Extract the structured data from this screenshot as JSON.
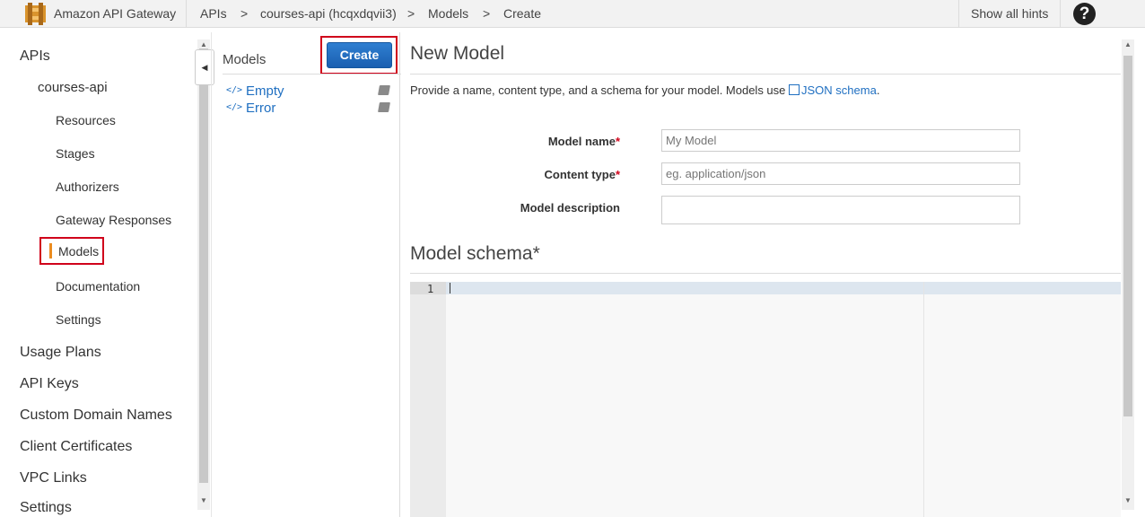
{
  "topbar": {
    "brand": "Amazon API Gateway",
    "breadcrumbs": [
      "APIs",
      "courses-api (hcqxdqvii3)",
      "Models",
      "Create"
    ],
    "separator": ">",
    "show_hints": "Show all hints",
    "help_glyph": "?"
  },
  "nav": {
    "apis": "APIs",
    "api_name": "courses-api",
    "sub_items": [
      "Resources",
      "Stages",
      "Authorizers",
      "Gateway Responses",
      "Models",
      "Documentation",
      "Settings"
    ],
    "active": "Models",
    "top_items": [
      "Usage Plans",
      "API Keys",
      "Custom Domain Names",
      "Client Certificates",
      "VPC Links",
      "Settings"
    ]
  },
  "models_panel": {
    "title": "Models",
    "create_label": "Create",
    "items": [
      {
        "code": "</>",
        "name": "Empty"
      },
      {
        "code": "</>",
        "name": "Error"
      }
    ]
  },
  "main": {
    "title": "New Model",
    "description_prefix": "Provide a name, content type, and a schema for your model. Models use ",
    "description_link": "JSON schema",
    "description_suffix": ".",
    "fields": {
      "model_name": {
        "label": "Model name",
        "required": "*",
        "placeholder": "My Model",
        "value": ""
      },
      "content_type": {
        "label": "Content type",
        "required": "*",
        "placeholder": "eg. application/json",
        "value": ""
      },
      "model_description": {
        "label": "Model description",
        "value": ""
      }
    },
    "schema_title": "Model schema",
    "schema_required": "*",
    "editor": {
      "line_numbers": [
        "1"
      ],
      "content": ""
    }
  },
  "colors": {
    "accent_blue": "#1f6fc1",
    "highlight_red": "#d0021b",
    "active_orange": "#eb8c1f"
  }
}
